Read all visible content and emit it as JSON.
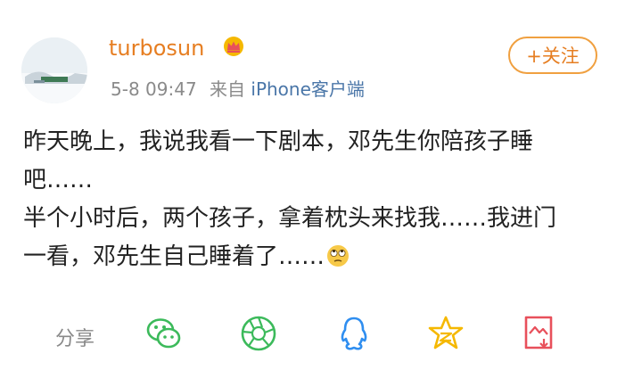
{
  "post": {
    "username": "turbosun",
    "date": "5-8",
    "time": "09:47",
    "source_prefix": "来自",
    "source": "iPhone客户端",
    "follow_label": "+关注",
    "lines": [
      "昨天晚上，我说我看一下剧本，邓先生你陪孩子睡",
      "吧……",
      "半个小时后，两个孩子，拿着枕头来找我……我进门",
      "一看，邓先生自己睡着了……"
    ]
  },
  "share": {
    "label": "分享",
    "icons": [
      "wechat-icon",
      "moments-icon",
      "qq-icon",
      "qzone-icon",
      "save-image-icon"
    ]
  },
  "colors": {
    "username": "#e67e22",
    "follow_border": "#f0a040",
    "meta": "#8a8a8a",
    "source": "#4a76a8",
    "icon_green": "#3cba5b",
    "icon_blue": "#2f8ef0",
    "icon_yellow": "#f5b800",
    "icon_red": "#e8505b"
  }
}
